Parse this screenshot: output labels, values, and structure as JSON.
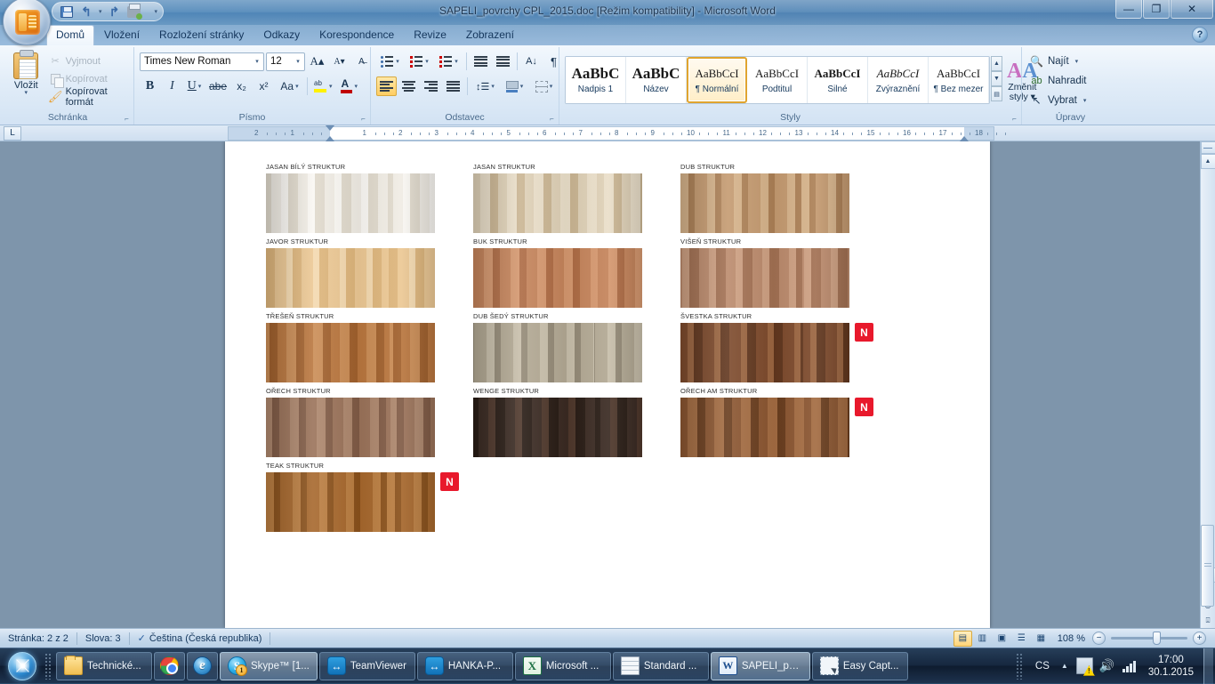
{
  "window": {
    "title": "SAPELI_povrchy CPL_2015.doc [Režim kompatibility] - Microsoft Word",
    "minimize": "—",
    "maximize": "❐",
    "close": "✕",
    "help": "?"
  },
  "quick_access": {
    "save": "save-icon",
    "undo": "↰",
    "undo_dropdown": "▾",
    "redo": "↱",
    "print_preview": "print-icon",
    "customize": "▾"
  },
  "tabs": [
    {
      "label": "Domů",
      "active": true
    },
    {
      "label": "Vložení",
      "active": false
    },
    {
      "label": "Rozložení stránky",
      "active": false
    },
    {
      "label": "Odkazy",
      "active": false
    },
    {
      "label": "Korespondence",
      "active": false
    },
    {
      "label": "Revize",
      "active": false
    },
    {
      "label": "Zobrazení",
      "active": false
    }
  ],
  "ribbon": {
    "clipboard": {
      "group_label": "Schránka",
      "paste_label": "Vložit",
      "paste_arrow": "▾",
      "cut": "Vyjmout",
      "copy": "Kopírovat",
      "format_painter": "Kopírovat formát",
      "launcher": "⌐"
    },
    "font": {
      "group_label": "Písmo",
      "font_name": "Times New Roman",
      "font_size": "12",
      "grow_font": "A",
      "shrink_font": "A",
      "clear_formatting": "Aa",
      "bold": "B",
      "italic": "I",
      "underline": "U",
      "strikethrough": "abe",
      "subscript": "x₂",
      "superscript": "x²",
      "change_case": "Aa",
      "highlight": "highlight-icon",
      "font_color": "font-color-icon",
      "caret": "▾",
      "launcher": "⌐"
    },
    "paragraph": {
      "group_label": "Odstavec",
      "bullets": "bullets-icon",
      "numbering": "numbering-icon",
      "multilevel": "multilevel-list-icon",
      "decrease_indent": "decrease-indent-icon",
      "increase_indent": "increase-indent-icon",
      "sort": "A↓",
      "show_marks": "¶",
      "align_left": "align-left-icon",
      "align_center": "align-center-icon",
      "align_right": "align-right-icon",
      "justify": "justify-icon",
      "line_spacing": "line-spacing-icon",
      "shading": "shading-icon",
      "borders": "borders-icon",
      "caret": "▾",
      "launcher": "⌐"
    },
    "styles": {
      "group_label": "Styly",
      "items": [
        {
          "preview": "AaBbC",
          "name": "Nadpis 1",
          "cls": "sp-h1",
          "selected": false
        },
        {
          "preview": "AaBbC",
          "name": "Název",
          "cls": "sp-title",
          "selected": false
        },
        {
          "preview": "AaBbCcI",
          "name": "¶ Normální",
          "cls": "sp-normal",
          "selected": true
        },
        {
          "preview": "AaBbCcI",
          "name": "Podtitul",
          "cls": "sp-sub",
          "selected": false
        },
        {
          "preview": "AaBbCcI",
          "name": "Silné",
          "cls": "sp-strong",
          "selected": false
        },
        {
          "preview": "AaBbCcI",
          "name": "Zvýraznění",
          "cls": "sp-emph",
          "selected": false
        },
        {
          "preview": "AaBbCcI",
          "name": "¶ Bez mezer",
          "cls": "sp-nospace",
          "selected": false
        }
      ],
      "scroll_up": "▲",
      "scroll_down": "▼",
      "more": "▤",
      "change_styles_line1": "Změnit",
      "change_styles_line2": "styly ▾",
      "launcher": "⌐"
    },
    "editing": {
      "group_label": "Úpravy",
      "find": "Najít",
      "replace": "Nahradit",
      "select": "Vybrat",
      "dropdown": "▾"
    }
  },
  "ruler": {
    "tab_selector": "L",
    "marks": [
      "2",
      "1",
      "1",
      "2",
      "3",
      "4",
      "5",
      "6",
      "7",
      "8",
      "9",
      "10",
      "11",
      "12",
      "13",
      "14",
      "15",
      "16",
      "17",
      "18"
    ]
  },
  "document": {
    "samples": [
      {
        "label": "JASAN BÍLÝ STRUKTUR",
        "base": "#f0ece4",
        "dark": "#ddd6c8",
        "light": "#fbf9f5",
        "badge": null
      },
      {
        "label": "JASAN STRUKTUR",
        "base": "#ded0b6",
        "dark": "#c6b08c",
        "light": "#ece1cc",
        "badge": null
      },
      {
        "label": "DUB STRUKTUR",
        "base": "#c49a70",
        "dark": "#a87c52",
        "light": "#d8b68e",
        "badge": null
      },
      {
        "label": "JAVOR STRUKTUR",
        "base": "#ecc894",
        "dark": "#dbb277",
        "light": "#f5dcb4",
        "badge": null
      },
      {
        "label": "BUK STRUKTUR",
        "base": "#c4835a",
        "dark": "#a9663f",
        "light": "#d89b72",
        "badge": null
      },
      {
        "label": "VIŠEŇ STRUKTUR",
        "base": "#bb8a6c",
        "dark": "#9e6c4e",
        "light": "#d0a385",
        "badge": null
      },
      {
        "label": "TŘEŠEŇ STRUKTUR",
        "base": "#b9763e",
        "dark": "#9c5c29",
        "light": "#cd9059",
        "badge": null
      },
      {
        "label": "DUB ŠEDÝ STRUKTUR",
        "base": "#b2a893",
        "dark": "#8e8471",
        "light": "#cbc2ae",
        "badge": null
      },
      {
        "label": "ŠVESTKA STRUKTUR",
        "base": "#7d4a2c",
        "dark": "#5c331b",
        "light": "#a06a44",
        "badge": "N"
      },
      {
        "label": "OŘECH STRUKTUR",
        "base": "#9a7259",
        "dark": "#7c5742",
        "light": "#b08a70",
        "badge": null
      },
      {
        "label": "WENGE STRUKTUR",
        "base": "#3a2a22",
        "dark": "#241811",
        "light": "#51392c",
        "badge": null
      },
      {
        "label": "OŘECH AM STRUKTUR",
        "base": "#8a5530",
        "dark": "#63381a",
        "light": "#a87045",
        "badge": "N"
      },
      {
        "label": "TEAK STRUKTUR",
        "base": "#a6672c",
        "dark": "#854d18",
        "light": "#bd8144",
        "badge": "N"
      }
    ]
  },
  "scrollbar": {
    "up": "▲",
    "down": "▼",
    "prev_page": "⍖",
    "browse_object": "◎",
    "next_page": "⍗",
    "split": "split-handle"
  },
  "status_bar": {
    "page": "Stránka: 2 z 2",
    "words": "Slova: 3",
    "proofing_icon": "proofing-icon",
    "language": "Čeština (Česká republika)",
    "views": [
      {
        "name": "print-layout-view",
        "glyph": "▤",
        "active": true
      },
      {
        "name": "full-screen-reading-view",
        "glyph": "▥",
        "active": false
      },
      {
        "name": "web-layout-view",
        "glyph": "▣",
        "active": false
      },
      {
        "name": "outline-view",
        "glyph": "☰",
        "active": false
      },
      {
        "name": "draft-view",
        "glyph": "▦",
        "active": false
      }
    ],
    "zoom_level": "108 %",
    "zoom_out": "−",
    "zoom_in": "+"
  },
  "taskbar": {
    "start": "start-orb",
    "buttons": [
      {
        "label": "Technické...",
        "icon": "ic-folder",
        "icon_name": "folder-icon",
        "active": false,
        "narrow": false
      },
      {
        "label": "",
        "icon": "ic-chrome",
        "icon_name": "chrome-icon",
        "active": false,
        "narrow": true
      },
      {
        "label": "",
        "icon": "ic-ie",
        "icon_name": "internet-explorer-icon",
        "active": false,
        "narrow": true
      },
      {
        "label": "Skype™ [1...",
        "icon": "ic-skype",
        "icon_name": "skype-icon",
        "active": true,
        "narrow": false
      },
      {
        "label": "TeamViewer",
        "icon": "ic-tv",
        "icon_name": "teamviewer-icon",
        "active": false,
        "narrow": false
      },
      {
        "label": "HANKA-P...",
        "icon": "ic-tv",
        "icon_name": "teamviewer-session-icon",
        "active": false,
        "narrow": false
      },
      {
        "label": "Microsoft ...",
        "icon": "ic-excel",
        "icon_name": "excel-icon",
        "active": false,
        "narrow": false
      },
      {
        "label": "Standard ...",
        "icon": "ic-generic-doc",
        "icon_name": "document-icon",
        "active": false,
        "narrow": false
      },
      {
        "label": "SAPELI_po...",
        "icon": "ic-word",
        "icon_name": "word-icon",
        "active": true,
        "narrow": false
      },
      {
        "label": "Easy Capt...",
        "icon": "ic-capture",
        "icon_name": "easy-capture-icon",
        "active": false,
        "narrow": false
      }
    ],
    "tray": {
      "language": "CS",
      "chevron": "▲",
      "network_icon": "network-warning-icon",
      "volume_icon": "🔊",
      "signal_icon": "signal-bars-icon",
      "time": "17:00",
      "date": "30.1.2015"
    }
  }
}
